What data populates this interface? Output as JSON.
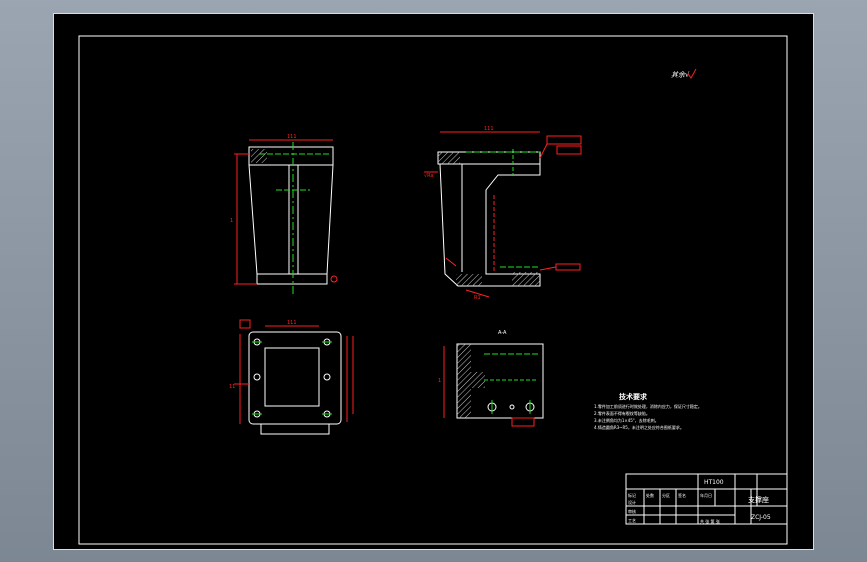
{
  "colors": {
    "background": "#000000",
    "outline": "#ffffff",
    "dimension": "#ff2020",
    "centerline": "#20e020",
    "hatch": "#c8c8c8"
  },
  "roughness_note": "其余√",
  "tech_requirements": {
    "title": "技术要求",
    "items": [
      "1.零件加工前须进行时效处理，消除内应力，保证尺寸稳定。",
      "2.零件表面不得有裂纹等缺陷。",
      "3.未注倒角均为1×45°，去除毛刺。",
      "4.铸造圆角R3~R5，未注明之处应符合图纸要求。"
    ]
  },
  "title_block": {
    "material": "HT100",
    "part_name": "支撑座",
    "drawing_no": "ZCJ-05",
    "row_labels": [
      "标记",
      "设计",
      "审核",
      "工艺"
    ],
    "col_labels": [
      "处数",
      "分区",
      "签名",
      "年月日"
    ],
    "sheet_info": "共 张  第 张"
  }
}
